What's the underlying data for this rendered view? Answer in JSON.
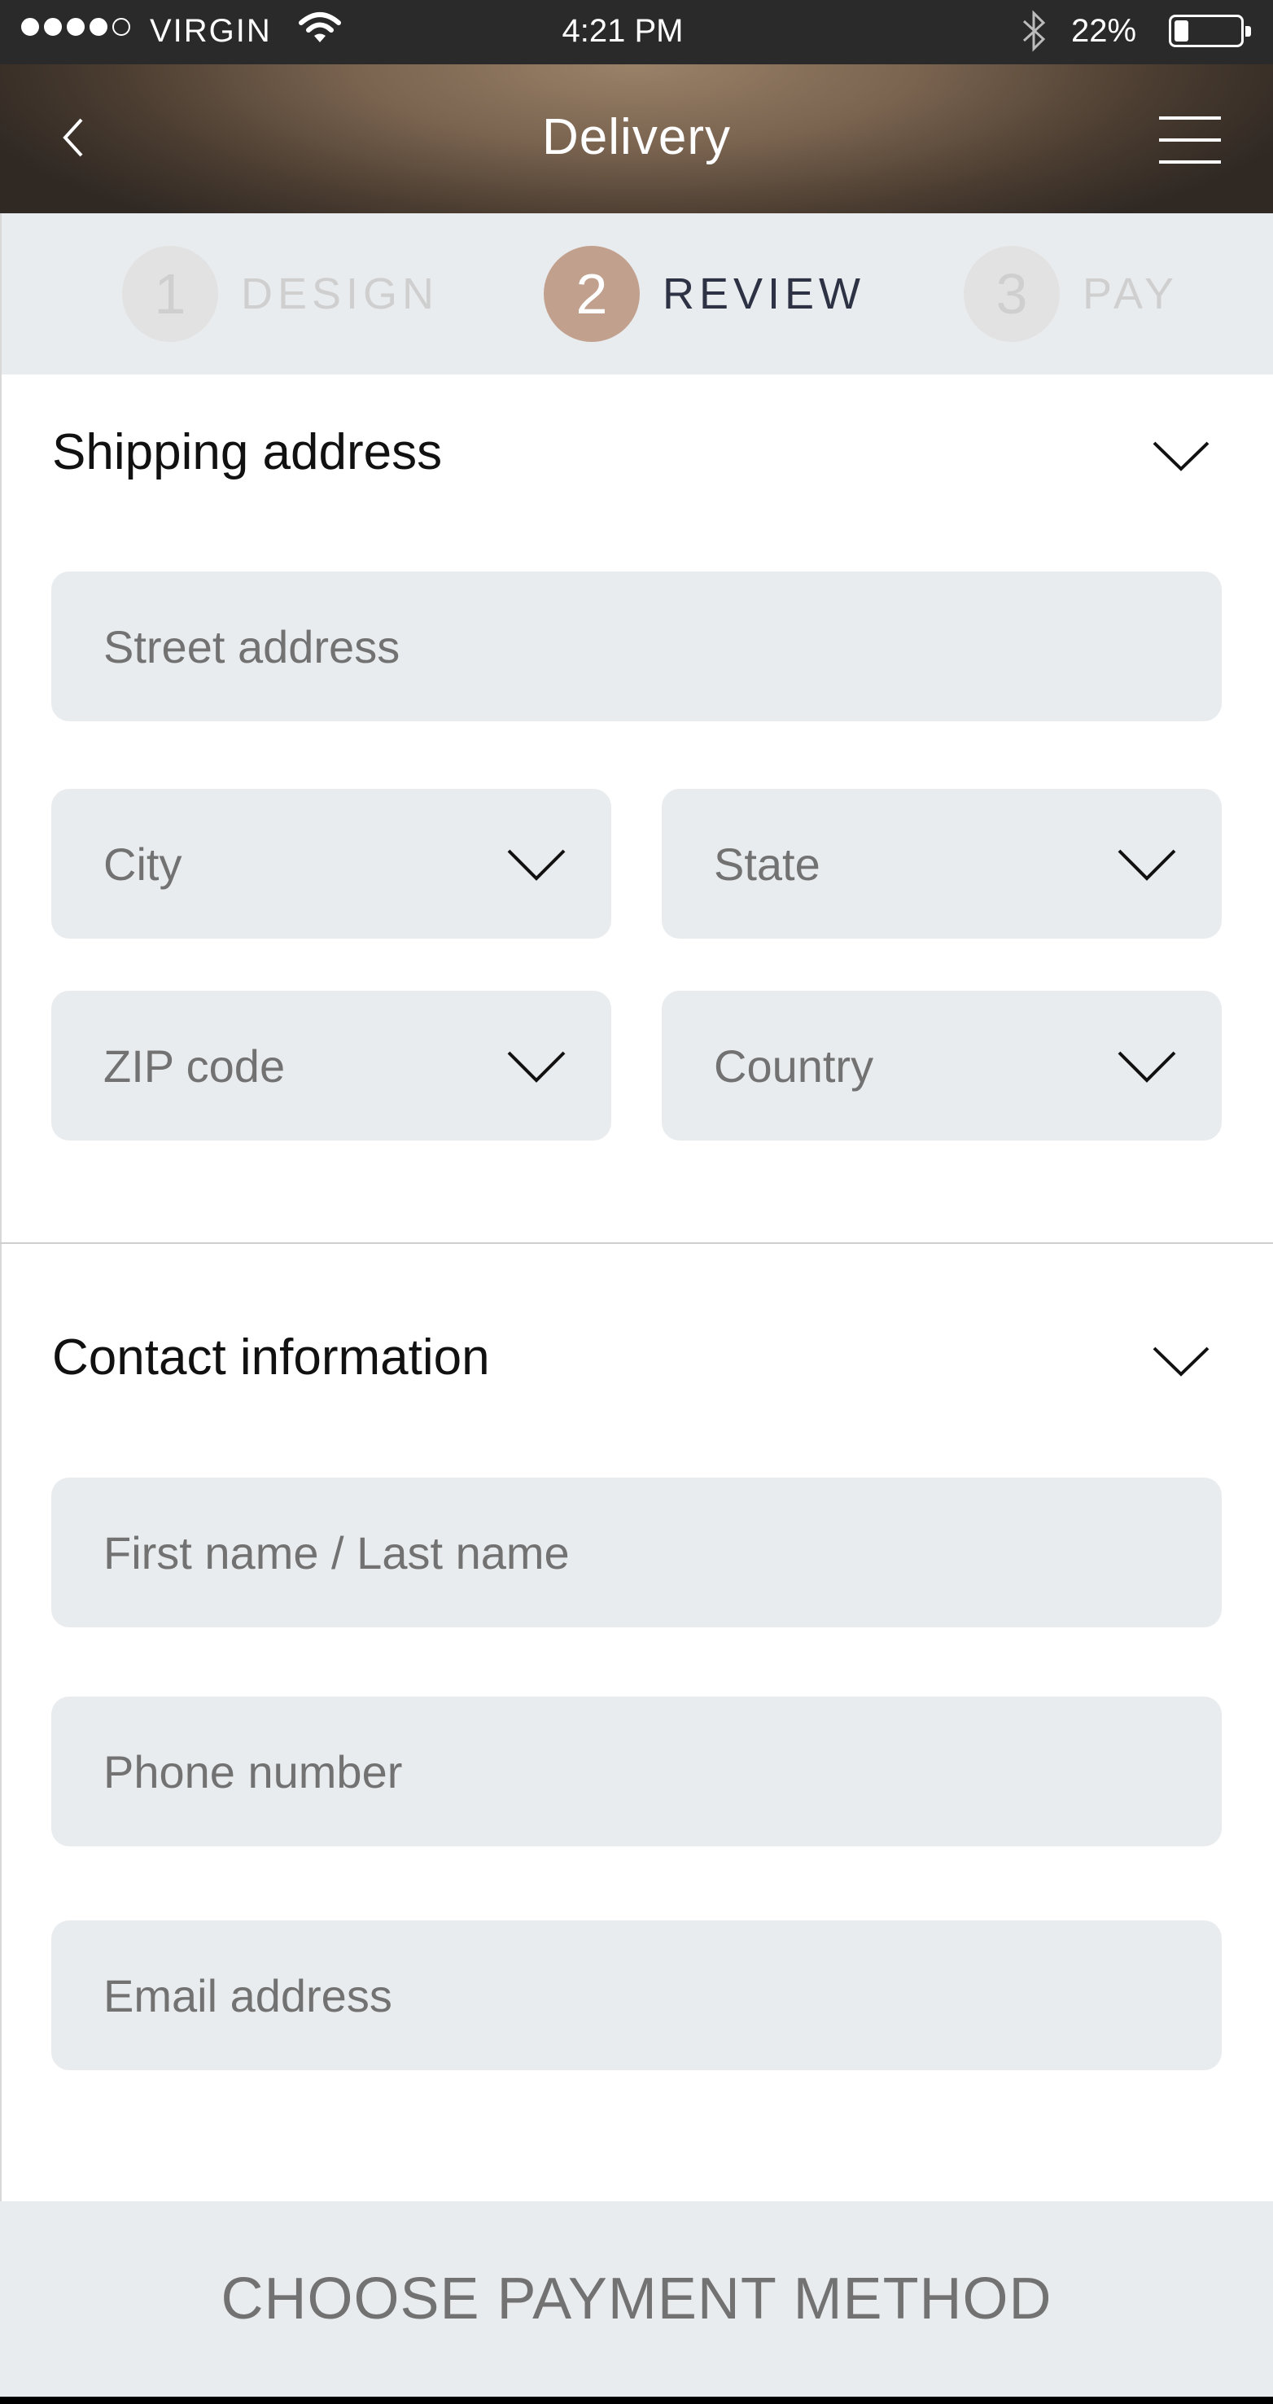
{
  "status_bar": {
    "signal_bars": [
      true,
      true,
      true,
      true,
      false
    ],
    "carrier": "VIRGIN",
    "time": "4:21 PM",
    "battery_percent": "22%",
    "battery_level": 0.22,
    "icons": [
      "wifi-icon",
      "bluetooth-icon",
      "battery-icon"
    ]
  },
  "header": {
    "title": "Delivery",
    "back_icon": "chevron-left-icon",
    "menu_icon": "hamburger-icon"
  },
  "stepper": {
    "steps": [
      {
        "number": "1",
        "label": "DESIGN",
        "active": false
      },
      {
        "number": "2",
        "label": "REVIEW",
        "active": true
      },
      {
        "number": "3",
        "label": "PAY",
        "active": false
      }
    ]
  },
  "shipping": {
    "title": "Shipping address",
    "street_placeholder": "Street address",
    "city_placeholder": "City",
    "state_placeholder": "State",
    "zip_placeholder": "ZIP code",
    "country_placeholder": "Country"
  },
  "contact": {
    "title": "Contact information",
    "name_placeholder": "First name / Last name",
    "phone_placeholder": "Phone number",
    "email_placeholder": "Email address"
  },
  "cta": {
    "label": "CHOOSE PAYMENT METHOD"
  },
  "colors": {
    "accent": "#c1a08e",
    "field_bg": "#e9ecee",
    "active_step_text": "#2d3344"
  }
}
